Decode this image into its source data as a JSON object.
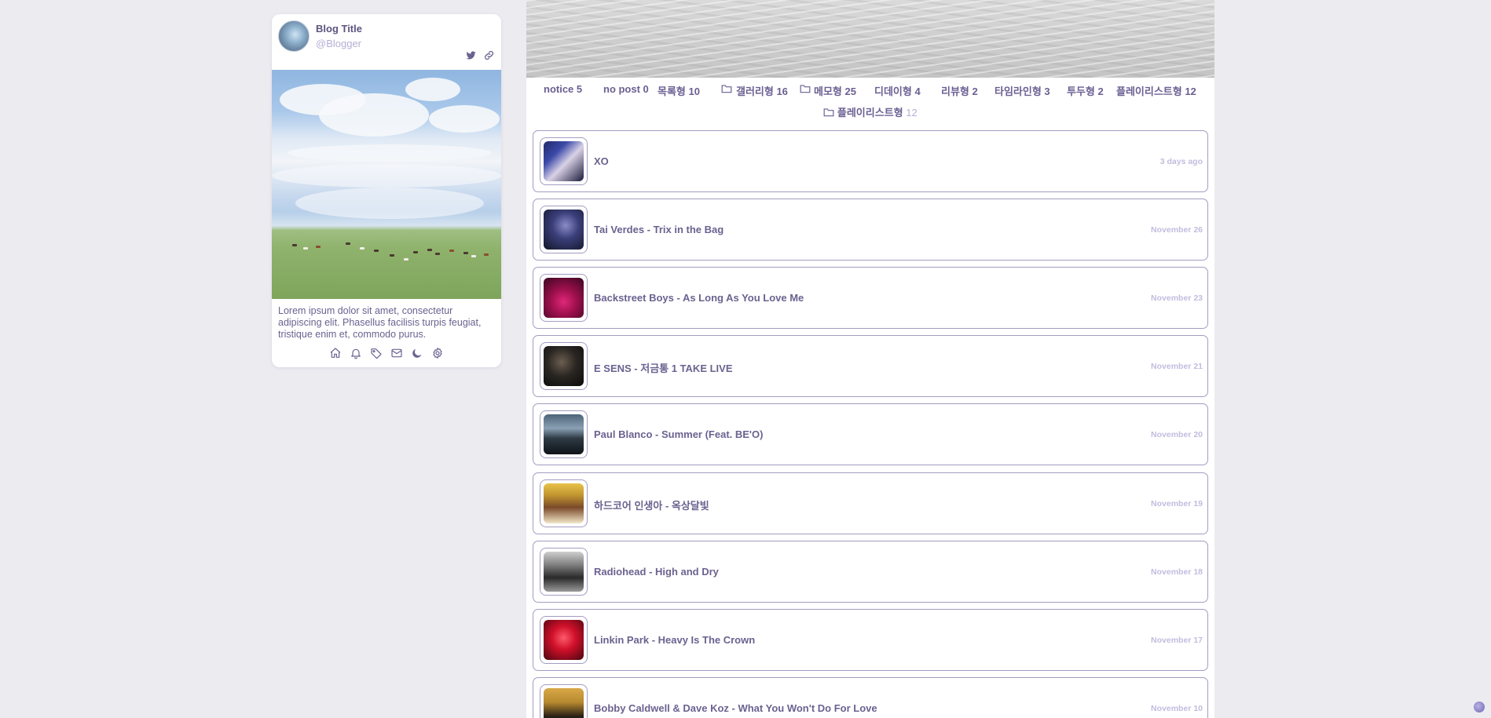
{
  "profile": {
    "title": "Blog Title",
    "handle": "@Blogger",
    "social_icons": [
      "twitter-icon",
      "link-icon"
    ],
    "about": "Lorem ipsum dolor sit amet, consectetur adipiscing elit. Phasellus facilisis turpis feugiat, tristique enim et, commodo purus.",
    "menu_icons": [
      "home-icon",
      "bell-icon",
      "tag-icon",
      "mail-icon",
      "moon-icon",
      "gear-icon"
    ]
  },
  "categories": {
    "line1": [
      {
        "label": "notice 5",
        "folder": false
      },
      {
        "label": "no post 0",
        "folder": false
      },
      {
        "label": "목록형 10",
        "folder": false
      },
      {
        "label": "갤러리형 16",
        "folder": true
      },
      {
        "label": "메모형 25",
        "folder": true
      },
      {
        "label": "디데이형 4",
        "folder": false
      },
      {
        "label": "리뷰형 2",
        "folder": false
      },
      {
        "label": "타임라인형 3",
        "folder": false
      },
      {
        "label": "투두형 2",
        "folder": false
      },
      {
        "label": "플레이리스트형 12",
        "folder": false
      }
    ],
    "active": {
      "label": "플레이리스트형",
      "count": "12"
    }
  },
  "posts": [
    {
      "title": "XO",
      "date": "3 days ago"
    },
    {
      "title": "Tai Verdes - Trix in the Bag",
      "date": "November 26"
    },
    {
      "title": "Backstreet Boys - As Long As You Love Me",
      "date": "November 23"
    },
    {
      "title": "E SENS - 저금통 1 TAKE LIVE",
      "date": "November 21"
    },
    {
      "title": "Paul Blanco - Summer (Feat. BE'O)",
      "date": "November 20"
    },
    {
      "title": "하드코어 인생아 - 옥상달빛",
      "date": "November 19"
    },
    {
      "title": "Radiohead - High and Dry",
      "date": "November 18"
    },
    {
      "title": "Linkin Park - Heavy Is The Crown",
      "date": "November 17"
    },
    {
      "title": "Bobby Caldwell & Dave Koz - What You Won't Do For Love",
      "date": "November 10"
    }
  ],
  "colors": {
    "accent": "#6b6290",
    "muted": "#b6aed6",
    "border": "#a49cc2",
    "background": "#ecebf0"
  }
}
